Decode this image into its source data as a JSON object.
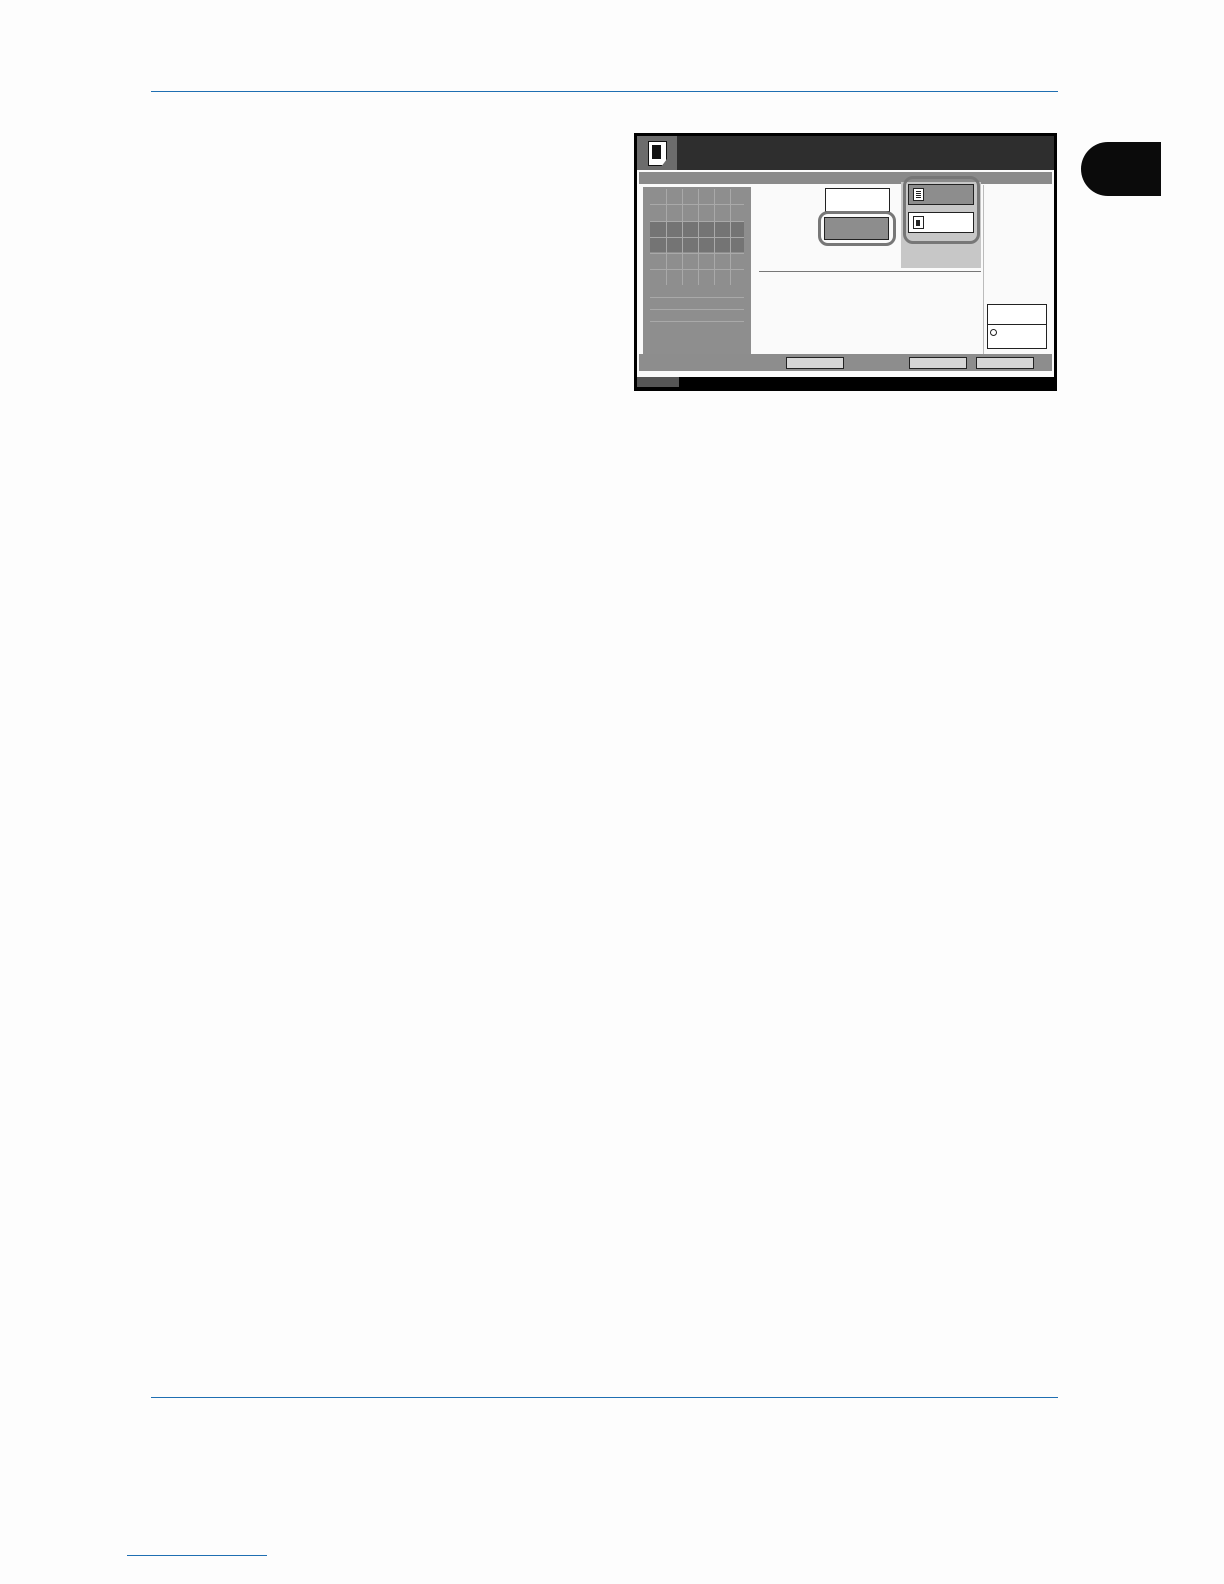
{
  "page": {
    "title": "",
    "chapter_tab_label": ""
  },
  "panel": {
    "title": "",
    "left_pane_label": "",
    "button_white_label": "",
    "button_selected_label": "",
    "option_1_label": "",
    "option_2_label": "",
    "side_box_label": "",
    "bottom_buttons": [
      "",
      "",
      ""
    ],
    "icons": [
      "document-icon",
      "text-document-icon",
      "document-icon"
    ]
  },
  "colors": {
    "rule": "#1f6fb2",
    "panel_dark": "#2e2e2e",
    "panel_grey": "#8d8d8d",
    "highlight_ring": "#777777"
  }
}
